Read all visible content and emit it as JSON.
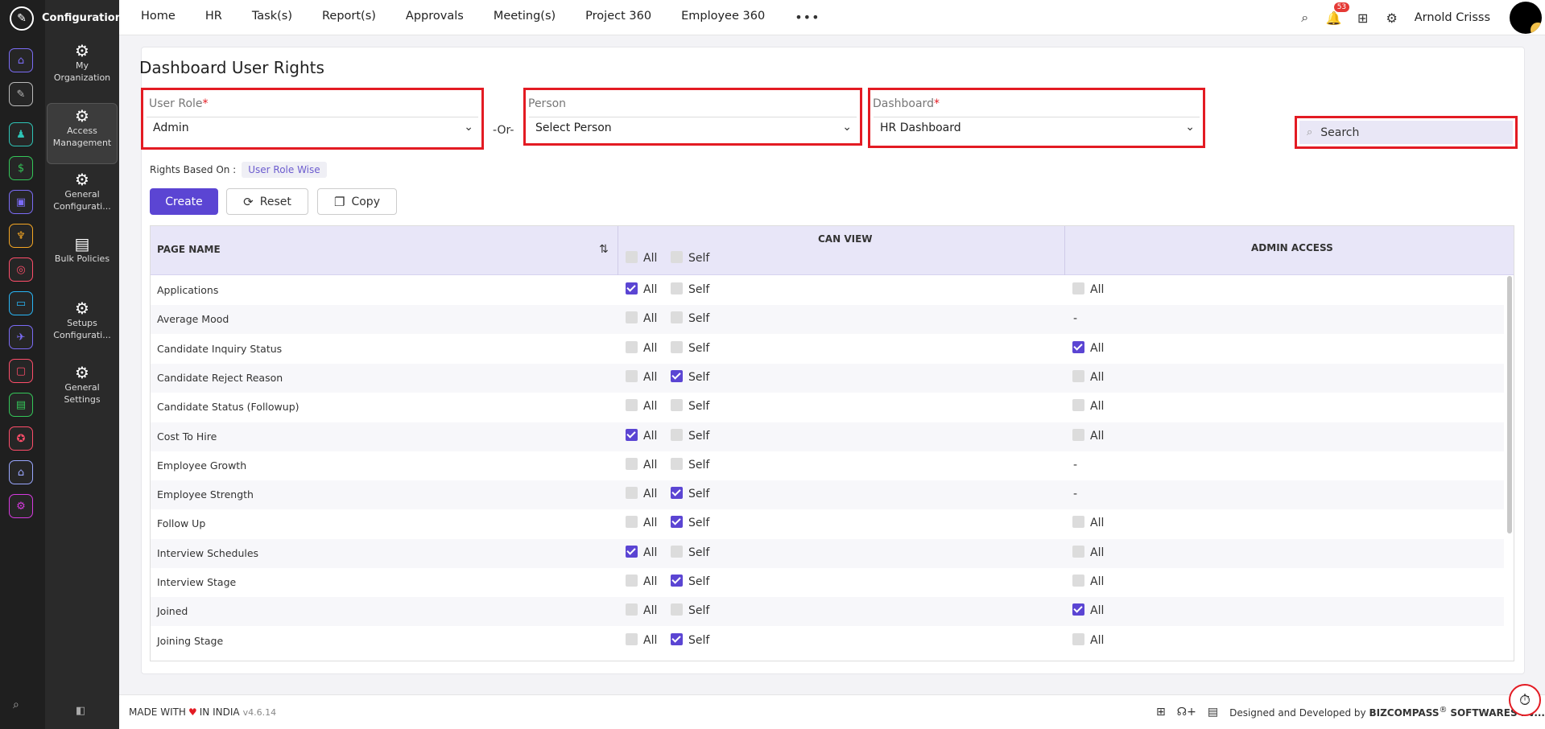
{
  "rail": {
    "icons": [
      "home-icon",
      "pin-icon",
      "org-icon",
      "money-icon",
      "briefcase-icon",
      "wheat-icon",
      "target-icon",
      "box-icon",
      "plane-icon",
      "monitor-icon",
      "doc-icon",
      "badge-icon",
      "house-icon",
      "settings-icon"
    ],
    "colors": [
      "#7b6cf6",
      "#bbbbbb",
      "#2ec4b6",
      "#34c759",
      "#7b6cf6",
      "#f5a623",
      "#ff4d6a",
      "#29b6f6",
      "#7b6cf6",
      "#ff4d6a",
      "#34c759",
      "#ff4d6a",
      "#9aa7ff",
      "#d63adf"
    ]
  },
  "sidebar": {
    "title": "Configuration",
    "items": [
      {
        "label_1": "My",
        "label_2": "Organization"
      },
      {
        "label_1": "Access",
        "label_2": "Management"
      },
      {
        "label_1": "General",
        "label_2": "Configurati..."
      },
      {
        "label_1": "Bulk Policies",
        "label_2": ""
      },
      {
        "label_1": "Setups",
        "label_2": "Configurati..."
      },
      {
        "label_1": "General",
        "label_2": "Settings"
      }
    ]
  },
  "topbar": {
    "nav": [
      "Home",
      "HR",
      "Task(s)",
      "Report(s)",
      "Approvals",
      "Meeting(s)",
      "Project 360",
      "Employee 360"
    ],
    "more": "•••",
    "notif_count": "53",
    "user_name": "Arnold Crisss"
  },
  "page": {
    "title": "Dashboard User Rights",
    "user_role_label": "User Role",
    "user_role_value": "Admin",
    "or_text": "-Or-",
    "person_label": "Person",
    "person_value": "Select Person",
    "dashboard_label": "Dashboard",
    "dashboard_value": "HR Dashboard",
    "req": "*",
    "search_placeholder": "Search",
    "rights_label": "Rights Based On :",
    "rights_value": "User Role Wise",
    "create": "Create",
    "reset": "Reset",
    "copy": "Copy"
  },
  "table": {
    "col_page": "PAGE NAME",
    "col_view": "CAN VIEW",
    "col_admin": "ADMIN ACCESS",
    "all": "All",
    "self": "Self",
    "dash": "-",
    "rows": [
      {
        "name": "Applications",
        "view_all": true,
        "view_self": false,
        "admin": false
      },
      {
        "name": "Average Mood",
        "view_all": false,
        "view_self": false,
        "admin": null
      },
      {
        "name": "Candidate Inquiry Status",
        "view_all": false,
        "view_self": false,
        "admin": true
      },
      {
        "name": "Candidate Reject Reason",
        "view_all": false,
        "view_self": true,
        "admin": false
      },
      {
        "name": "Candidate Status (Followup)",
        "view_all": false,
        "view_self": false,
        "admin": false
      },
      {
        "name": "Cost To Hire",
        "view_all": true,
        "view_self": false,
        "admin": false
      },
      {
        "name": "Employee Growth",
        "view_all": false,
        "view_self": false,
        "admin": null
      },
      {
        "name": "Employee Strength",
        "view_all": false,
        "view_self": true,
        "admin": null
      },
      {
        "name": "Follow Up",
        "view_all": false,
        "view_self": true,
        "admin": false
      },
      {
        "name": "Interview Schedules",
        "view_all": true,
        "view_self": false,
        "admin": false
      },
      {
        "name": "Interview Stage",
        "view_all": false,
        "view_self": true,
        "admin": false
      },
      {
        "name": "Joined",
        "view_all": false,
        "view_self": false,
        "admin": true
      },
      {
        "name": "Joining Stage",
        "view_all": false,
        "view_self": true,
        "admin": false
      }
    ]
  },
  "footer": {
    "made_with": "MADE WITH",
    "in_india": "IN INDIA",
    "version": "v4.6.14",
    "designed": "Designed and Developed by",
    "company": "BIZCOMPASS",
    "reg": "®",
    "company_rest": "SOFTWARES PV..."
  }
}
